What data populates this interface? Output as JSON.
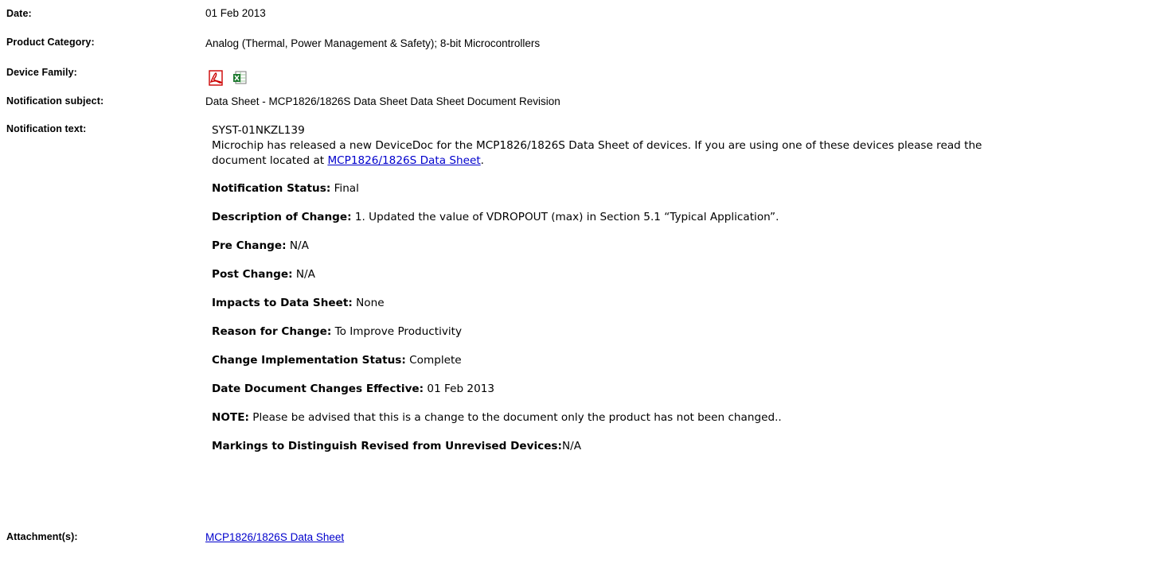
{
  "fields": {
    "date_label": "Date:",
    "date_value": "01 Feb 2013",
    "product_category_label": "Product Category:",
    "product_category_value": "Analog (Thermal, Power Management & Safety); 8-bit Microcontrollers",
    "device_family_label": "Device Family:",
    "device_family_icons": [
      "pdf-icon",
      "excel-icon"
    ],
    "notification_subject_label": "Notification subject:",
    "notification_subject_value": "Data Sheet - MCP1826/1826S Data Sheet Data Sheet Document Revision",
    "notification_text_label": "Notification text:",
    "attachments_label": "Attachment(s):",
    "attachment_link": "MCP1826/1826S Data Sheet"
  },
  "notification": {
    "id": "SYST-01NKZL139",
    "intro": "Microchip has released a new DeviceDoc for the MCP1826/1826S Data Sheet of devices. If you are using one of these devices please read the",
    "intro_line2_prefix": "document located at ",
    "intro_link": "MCP1826/1826S Data Sheet",
    "intro_line2_suffix": ".",
    "status_label": "Notification Status:",
    "status_value": " Final",
    "description_label": "Description of Change:",
    "description_value": " 1. Updated the value of VDROPOUT (max) in Section 5.1 “Typical Application”.",
    "pre_change_label": "Pre Change:",
    "pre_change_value": " N/A",
    "post_change_label": "Post Change:",
    "post_change_value": " N/A",
    "impacts_label": "Impacts to Data Sheet:",
    "impacts_value": " None",
    "reason_label": "Reason for Change:",
    "reason_value": " To Improve Productivity",
    "impl_status_label": "Change Implementation Status:",
    "impl_status_value": " Complete",
    "effective_label": "Date Document Changes Effective:",
    "effective_value": " 01 Feb 2013",
    "note_label": "NOTE:",
    "note_value": " Please be advised that this is a change to the document only the product has not been changed..",
    "markings_label": "Markings to Distinguish Revised from Unrevised Devices:",
    "markings_value": "N/A"
  },
  "colors": {
    "link": "#0000cc",
    "pdf_icon": "#cc0000",
    "excel_icon": "#1d7a2f"
  }
}
